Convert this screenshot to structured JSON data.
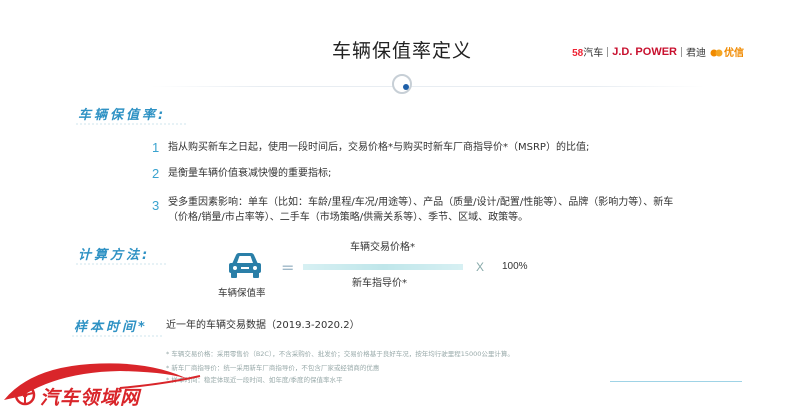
{
  "header": {
    "title": "车辆保值率定义",
    "logos": {
      "logo58": "58",
      "logo58_suffix": "汽车",
      "jdpower": "J.D. POWER",
      "junyou": "君迪",
      "youxin": "优信"
    }
  },
  "sections": {
    "definition_heading": "车辆保值率:",
    "definition_items": [
      {
        "num": "1",
        "text": "指从购买新车之日起，使用一段时间后，交易价格*与购买时新车厂商指导价*（MSRP）的比值;"
      },
      {
        "num": "2",
        "text": "是衡量车辆价值衰减快慢的重要指标;"
      },
      {
        "num": "3",
        "text_line1": "受多重因素影响：单车（比如：车龄/里程/车况/用途等）、产品（质量/设计/配置/性能等）、品牌（影响力等）、新车",
        "text_line2": "（价格/销量/市占率等）、二手车（市场策略/供需关系等）、季节、区域、政策等。"
      }
    ],
    "formula_heading": "计算方法:",
    "formula": {
      "icon_label": "车辆保值率",
      "equals": "=",
      "numerator": "车辆交易价格*",
      "denominator": "新车指导价*",
      "times": "X",
      "multiplier": "100%"
    },
    "sample_heading": "样本时间*",
    "sample_text": "近一年的车辆交易数据（2019.3-2020.2）"
  },
  "footnotes": [
    "* 车辆交易价格：采用零售价（B2C），不含采购价、批发价；交易价格基于良好车况，按年均行驶里程15000公里计算。",
    "* 新车厂商指导价：统一采用新车厂商指导价，不包含厂家或经销商的优惠",
    "* 样本时间：稳定体现近一段时间、如年度/季度的保值率水平"
  ],
  "watermark": {
    "text": "汽车领域网"
  },
  "colors": {
    "accent": "#2f92c4",
    "watermark_red": "#d9252a",
    "car_icon": "#2a7fa8"
  }
}
